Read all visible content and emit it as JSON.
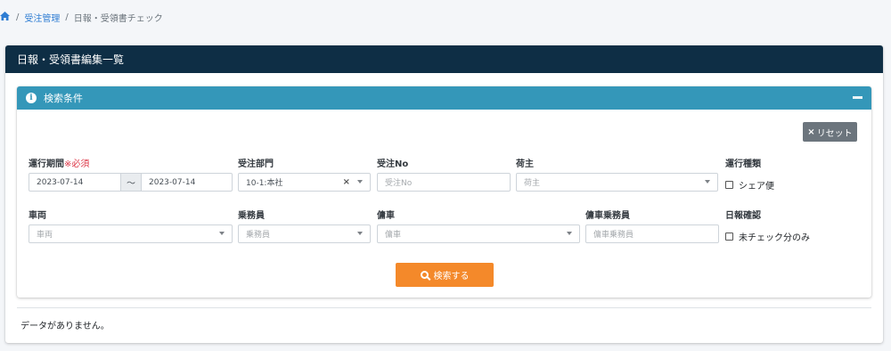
{
  "breadcrumb": {
    "home_icon": "home-icon",
    "sep": "/",
    "parent": "受注管理",
    "current": "日報・受領書チェック"
  },
  "page": {
    "title": "日報・受領書編集一覧"
  },
  "search": {
    "title": "検索条件",
    "info_icon": "i",
    "reset_label": "リセット",
    "reset_x": "×",
    "submit_label": "検索する",
    "fields": {
      "period": {
        "label": "運行期間",
        "required": "※必須",
        "from": "2023-07-14",
        "tilde": "〜",
        "to": "2023-07-14"
      },
      "department": {
        "label": "受注部門",
        "value": "10-1:本社",
        "clear": "×"
      },
      "order_no": {
        "label": "受注No",
        "placeholder": "受注No"
      },
      "shipper": {
        "label": "荷主",
        "placeholder": "荷主"
      },
      "operation_type": {
        "label": "運行種類",
        "checkbox_label": "シェア便"
      },
      "vehicle": {
        "label": "車両",
        "placeholder": "車両"
      },
      "crew": {
        "label": "乗務員",
        "placeholder": "乗務員"
      },
      "charter_vehicle": {
        "label": "傭車",
        "placeholder": "傭車"
      },
      "charter_crew": {
        "label": "傭車乗務員",
        "placeholder": "傭車乗務員"
      },
      "report_check": {
        "label": "日報確認",
        "checkbox_label": "未チェック分のみ"
      }
    }
  },
  "results": {
    "empty_message": "データがありません。"
  }
}
